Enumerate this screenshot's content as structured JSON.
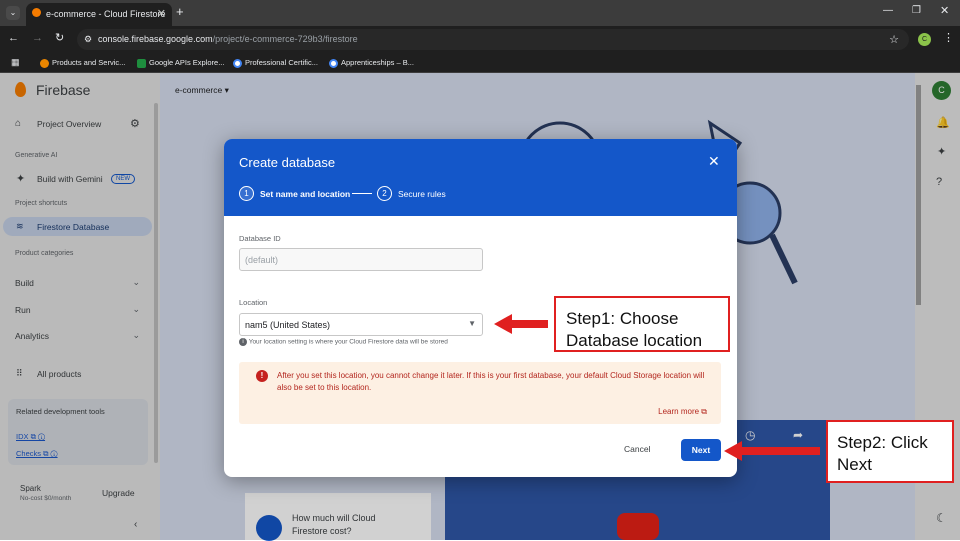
{
  "browser": {
    "tab_title": "e-commerce - Cloud Firestore",
    "url_host": "console.firebase.google.com",
    "url_path": "/project/e-commerce-729b3/firestore",
    "bookmarks": [
      "Products and Servic...",
      "Google APIs Explore...",
      "Professional Certific...",
      "Apprenticeships – B..."
    ],
    "profile_initial": "C"
  },
  "sidebar": {
    "brand": "Firebase",
    "project_overview": "Project Overview",
    "section_genai": "Generative AI",
    "build_with_gemini": "Build with Gemini",
    "new_badge": "NEW",
    "section_shortcuts": "Project shortcuts",
    "firestore": "Firestore Database",
    "section_categories": "Product categories",
    "groups": [
      "Build",
      "Run",
      "Analytics"
    ],
    "all_products": "All products",
    "related_title": "Related development tools",
    "idx": "IDX",
    "checks": "Checks",
    "plan_name": "Spark",
    "plan_cost": "No-cost $0/month",
    "upgrade": "Upgrade"
  },
  "page": {
    "project_selector": "e-commerce",
    "card_text": "How much will Cloud Firestore cost?"
  },
  "modal": {
    "title": "Create database",
    "step1_num": "1",
    "step1_label": "Set name and location",
    "step2_num": "2",
    "step2_label": "Secure rules",
    "dbid_label": "Database ID",
    "dbid_placeholder": "(default)",
    "location_label": "Location",
    "location_value": "nam5 (United States)",
    "location_hint": "Your location setting is where your Cloud Firestore data will be stored",
    "warning": "After you set this location, you cannot change it later. If this is your first database, your default Cloud Storage location will also be set to this location.",
    "learn_more": "Learn more",
    "cancel": "Cancel",
    "next": "Next"
  },
  "annotations": {
    "step1": "Step1: Choose Database location",
    "step2": "Step2: Click Next",
    "color": "#e02020"
  }
}
